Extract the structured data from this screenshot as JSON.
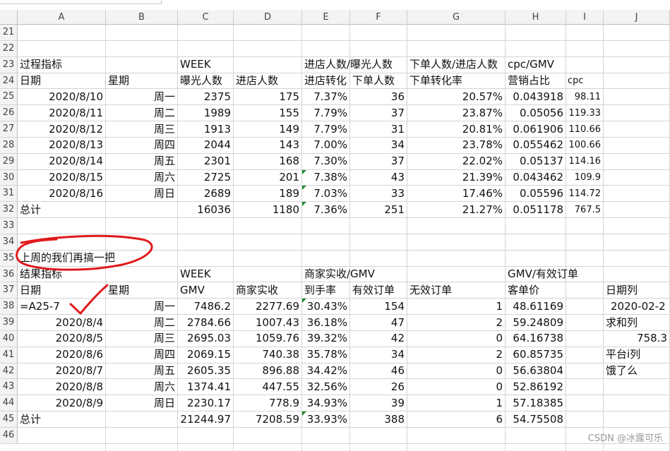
{
  "columns": [
    "A",
    "B",
    "C",
    "D",
    "E",
    "F",
    "G",
    "H",
    "I",
    "J"
  ],
  "rows": [
    {
      "num": "21",
      "cells": []
    },
    {
      "num": "22",
      "cells": []
    },
    {
      "num": "23",
      "cells": [
        [
          "A",
          "过程指标"
        ],
        [
          "C",
          "WEEK"
        ],
        [
          "E",
          "进店人数/曝光人数"
        ],
        [
          "G",
          "下单人数/进店人数"
        ],
        [
          "H",
          "cpc/GMV"
        ]
      ]
    },
    {
      "num": "24",
      "cells": [
        [
          "A",
          "日期"
        ],
        [
          "B",
          "星期"
        ],
        [
          "C",
          "曝光人数"
        ],
        [
          "D",
          "进店人数"
        ],
        [
          "E",
          "进店转化"
        ],
        [
          "F",
          "下单人数"
        ],
        [
          "G",
          "下单转化率"
        ],
        [
          "H",
          "营销占比"
        ],
        [
          "I",
          "cpc"
        ]
      ]
    },
    {
      "num": "25",
      "cells": [
        [
          "A",
          "2020/8/10"
        ],
        [
          "B",
          "周一"
        ],
        [
          "C",
          "2375"
        ],
        [
          "D",
          "175"
        ],
        [
          "E",
          "7.37%"
        ],
        [
          "F",
          "36"
        ],
        [
          "G",
          "20.57%"
        ],
        [
          "H",
          "0.043918"
        ],
        [
          "I",
          "98.11"
        ]
      ]
    },
    {
      "num": "26",
      "cells": [
        [
          "A",
          "2020/8/11"
        ],
        [
          "B",
          "周二"
        ],
        [
          "C",
          "1989"
        ],
        [
          "D",
          "155"
        ],
        [
          "E",
          "7.79%"
        ],
        [
          "F",
          "37"
        ],
        [
          "G",
          "23.87%"
        ],
        [
          "H",
          "0.05056"
        ],
        [
          "I",
          "119.33"
        ]
      ]
    },
    {
      "num": "27",
      "cells": [
        [
          "A",
          "2020/8/12"
        ],
        [
          "B",
          "周三"
        ],
        [
          "C",
          "1913"
        ],
        [
          "D",
          "149"
        ],
        [
          "E",
          "7.79%"
        ],
        [
          "F",
          "31"
        ],
        [
          "G",
          "20.81%"
        ],
        [
          "H",
          "0.061906"
        ],
        [
          "I",
          "110.66"
        ]
      ]
    },
    {
      "num": "28",
      "cells": [
        [
          "A",
          "2020/8/13"
        ],
        [
          "B",
          "周四"
        ],
        [
          "C",
          "2044"
        ],
        [
          "D",
          "143"
        ],
        [
          "E",
          "7.00%"
        ],
        [
          "F",
          "34"
        ],
        [
          "G",
          "23.78%"
        ],
        [
          "H",
          "0.055462"
        ],
        [
          "I",
          "100.66"
        ]
      ]
    },
    {
      "num": "29",
      "cells": [
        [
          "A",
          "2020/8/14"
        ],
        [
          "B",
          "周五"
        ],
        [
          "C",
          "2301"
        ],
        [
          "D",
          "168"
        ],
        [
          "E",
          "7.30%"
        ],
        [
          "F",
          "37"
        ],
        [
          "G",
          "22.02%"
        ],
        [
          "H",
          "0.05137"
        ],
        [
          "I",
          "114.16"
        ]
      ]
    },
    {
      "num": "30",
      "cells": [
        [
          "A",
          "2020/8/15"
        ],
        [
          "B",
          "周六"
        ],
        [
          "C",
          "2725"
        ],
        [
          "D",
          "201"
        ],
        [
          "E",
          "7.38%"
        ],
        [
          "F",
          "43"
        ],
        [
          "G",
          "21.39%"
        ],
        [
          "H",
          "0.043462"
        ],
        [
          "I",
          "109.9"
        ]
      ]
    },
    {
      "num": "31",
      "cells": [
        [
          "A",
          "2020/8/16"
        ],
        [
          "B",
          "周日"
        ],
        [
          "C",
          "2689"
        ],
        [
          "D",
          "189"
        ],
        [
          "E",
          "7.03%"
        ],
        [
          "F",
          "33"
        ],
        [
          "G",
          "17.46%"
        ],
        [
          "H",
          "0.05596"
        ],
        [
          "I",
          "114.72"
        ]
      ]
    },
    {
      "num": "32",
      "cells": [
        [
          "A",
          "总计"
        ],
        [
          "C",
          "16036"
        ],
        [
          "D",
          "1180"
        ],
        [
          "E",
          "7.36%"
        ],
        [
          "F",
          "251"
        ],
        [
          "G",
          "21.27%"
        ],
        [
          "H",
          "0.051178"
        ],
        [
          "I",
          "767.5"
        ]
      ]
    },
    {
      "num": "33",
      "cells": []
    },
    {
      "num": "34",
      "cells": []
    },
    {
      "num": "35",
      "cells": [
        [
          "A",
          "上周的我们再搞一把"
        ]
      ]
    },
    {
      "num": "36",
      "cells": [
        [
          "A",
          "结果指标"
        ],
        [
          "C",
          "WEEK"
        ],
        [
          "E",
          "商家实收/GMV"
        ],
        [
          "H",
          "GMV/有效订单"
        ]
      ]
    },
    {
      "num": "37",
      "cells": [
        [
          "A",
          "日期"
        ],
        [
          "B",
          "星期"
        ],
        [
          "C",
          "GMV"
        ],
        [
          "D",
          "商家实收"
        ],
        [
          "E",
          "到手率"
        ],
        [
          "F",
          "有效订单"
        ],
        [
          "G",
          "无效订单"
        ],
        [
          "H",
          "客单价"
        ],
        [
          "J",
          "日期列"
        ]
      ]
    },
    {
      "num": "38",
      "cells": [
        [
          "A",
          "=A25-7"
        ],
        [
          "B",
          "周一"
        ],
        [
          "C",
          "7486.2"
        ],
        [
          "D",
          "2277.69"
        ],
        [
          "E",
          "30.43%"
        ],
        [
          "F",
          "154"
        ],
        [
          "G",
          "1"
        ],
        [
          "H",
          "48.61169"
        ],
        [
          "J",
          "2020-02-2"
        ]
      ]
    },
    {
      "num": "39",
      "cells": [
        [
          "A",
          "2020/8/4"
        ],
        [
          "B",
          "周二"
        ],
        [
          "C",
          "2784.66"
        ],
        [
          "D",
          "1007.43"
        ],
        [
          "E",
          "36.18%"
        ],
        [
          "F",
          "47"
        ],
        [
          "G",
          "2"
        ],
        [
          "H",
          "59.24809"
        ],
        [
          "J",
          "求和列"
        ]
      ]
    },
    {
      "num": "40",
      "cells": [
        [
          "A",
          "2020/8/5"
        ],
        [
          "B",
          "周三"
        ],
        [
          "C",
          "2695.03"
        ],
        [
          "D",
          "1059.76"
        ],
        [
          "E",
          "39.32%"
        ],
        [
          "F",
          "42"
        ],
        [
          "G",
          "0"
        ],
        [
          "H",
          "64.16738"
        ],
        [
          "J",
          "758.3"
        ]
      ]
    },
    {
      "num": "41",
      "cells": [
        [
          "A",
          "2020/8/6"
        ],
        [
          "B",
          "周四"
        ],
        [
          "C",
          "2069.15"
        ],
        [
          "D",
          "740.38"
        ],
        [
          "E",
          "35.78%"
        ],
        [
          "F",
          "34"
        ],
        [
          "G",
          "2"
        ],
        [
          "H",
          "60.85735"
        ],
        [
          "J",
          "平台i列"
        ]
      ]
    },
    {
      "num": "42",
      "cells": [
        [
          "A",
          "2020/8/7"
        ],
        [
          "B",
          "周五"
        ],
        [
          "C",
          "2605.35"
        ],
        [
          "D",
          "896.88"
        ],
        [
          "E",
          "34.42%"
        ],
        [
          "F",
          "46"
        ],
        [
          "G",
          "0"
        ],
        [
          "H",
          "56.63804"
        ],
        [
          "J",
          "饿了么"
        ]
      ]
    },
    {
      "num": "43",
      "cells": [
        [
          "A",
          "2020/8/8"
        ],
        [
          "B",
          "周六"
        ],
        [
          "C",
          "1374.41"
        ],
        [
          "D",
          "447.55"
        ],
        [
          "E",
          "32.56%"
        ],
        [
          "F",
          "26"
        ],
        [
          "G",
          "0"
        ],
        [
          "H",
          "52.86192"
        ]
      ]
    },
    {
      "num": "44",
      "cells": [
        [
          "A",
          "2020/8/9"
        ],
        [
          "B",
          "周日"
        ],
        [
          "C",
          "2230.17"
        ],
        [
          "D",
          "778.9"
        ],
        [
          "E",
          "34.93%"
        ],
        [
          "F",
          "39"
        ],
        [
          "G",
          "1"
        ],
        [
          "H",
          "57.18385"
        ]
      ]
    },
    {
      "num": "45",
      "cells": [
        [
          "A",
          "总计"
        ],
        [
          "C",
          "21244.97"
        ],
        [
          "D",
          "7208.59"
        ],
        [
          "E",
          "33.93%"
        ],
        [
          "F",
          "388"
        ],
        [
          "G",
          "6"
        ],
        [
          "H",
          "54.75508"
        ]
      ]
    },
    {
      "num": "46",
      "cells": []
    }
  ],
  "watermark": "CSDN @冰露可乐",
  "annotation_color": "#e0191b",
  "triangle_color": "#1c8a2e"
}
